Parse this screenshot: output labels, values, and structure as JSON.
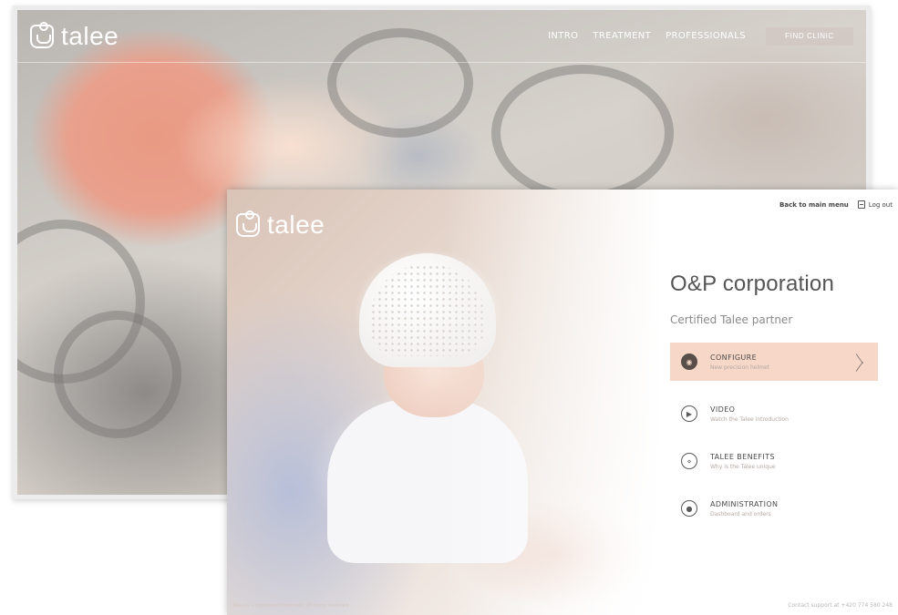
{
  "marketing_site": {
    "brand": "talee",
    "nav": {
      "links": [
        "INTRO",
        "TREATMENT",
        "PROFESSIONALS"
      ],
      "cta": "FIND CLINIC"
    }
  },
  "partner_portal": {
    "brand": "talee",
    "top_bar": {
      "back_link": "Back to main menu",
      "logout": "Log out"
    },
    "company_name": "O&P corporation",
    "partner_status": "Certified Talee partner",
    "menu": [
      {
        "icon": "helmet-icon",
        "title": "CONFIGURE",
        "description": "New precision helmet",
        "active": true
      },
      {
        "icon": "play-icon",
        "title": "VIDEO",
        "description": "Watch the Talee introduction",
        "active": false
      },
      {
        "icon": "talee-bear-icon",
        "title": "TALEE BENEFITS",
        "description": "Why is the Talee unique",
        "active": false
      },
      {
        "icon": "user-icon",
        "title": "ADMINISTRATION",
        "description": "Dashboard and orders",
        "active": false
      }
    ],
    "footer": {
      "copyright": "Talee is a registered trademark. All rights reserved.",
      "support": "Contact support at +420 774 580 248"
    }
  },
  "colors": {
    "accent_highlight": "#f6d7c8",
    "text_dark": "#4a4a4a",
    "text_muted": "#8a8a8a"
  }
}
